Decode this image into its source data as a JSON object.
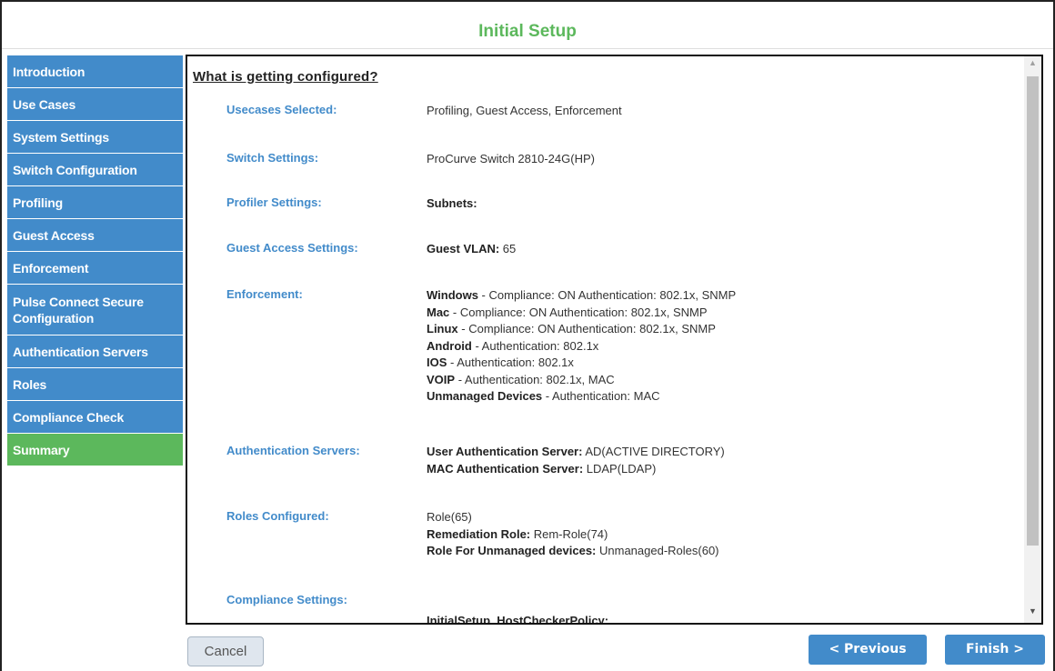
{
  "header": {
    "title": "Initial Setup"
  },
  "sidebar": {
    "items": [
      {
        "label": "Introduction"
      },
      {
        "label": "Use Cases"
      },
      {
        "label": "System Settings"
      },
      {
        "label": "Switch Configuration"
      },
      {
        "label": "Profiling"
      },
      {
        "label": "Guest Access"
      },
      {
        "label": "Enforcement"
      },
      {
        "label": "Pulse Connect Secure Configuration"
      },
      {
        "label": "Authentication Servers"
      },
      {
        "label": "Roles"
      },
      {
        "label": "Compliance Check"
      },
      {
        "label": "Summary",
        "active": true
      }
    ]
  },
  "content": {
    "heading": "What is getting configured?",
    "usecases": {
      "label": "Usecases Selected:",
      "value": "Profiling, Guest Access, Enforcement"
    },
    "switch": {
      "label": "Switch Settings:",
      "value": "ProCurve Switch 2810-24G(HP)"
    },
    "profiler": {
      "label": "Profiler Settings:",
      "key": "Subnets:"
    },
    "guest": {
      "label": "Guest Access Settings:",
      "key": "Guest VLAN:",
      "value": " 65"
    },
    "enforcement": {
      "label": "Enforcement:",
      "lines": [
        {
          "key": "Windows",
          "value": " - Compliance: ON Authentication: 802.1x, SNMP"
        },
        {
          "key": "Mac",
          "value": " - Compliance: ON Authentication: 802.1x, SNMP"
        },
        {
          "key": "Linux",
          "value": " - Compliance: ON Authentication: 802.1x, SNMP"
        },
        {
          "key": "Android",
          "value": " - Authentication: 802.1x"
        },
        {
          "key": "IOS",
          "value": " - Authentication: 802.1x"
        },
        {
          "key": "VOIP",
          "value": " - Authentication: 802.1x, MAC"
        },
        {
          "key": "Unmanaged Devices",
          "value": " - Authentication: MAC"
        }
      ]
    },
    "auth_servers": {
      "label": "Authentication Servers:",
      "lines": [
        {
          "key": "User Authentication Server:",
          "value": " AD(ACTIVE DIRECTORY)"
        },
        {
          "key": "MAC Authentication Server:",
          "value": " LDAP(LDAP)"
        }
      ]
    },
    "roles": {
      "label": "Roles Configured:",
      "plain": "Role(65)",
      "lines": [
        {
          "key": "Remediation Role:",
          "value": " Rem-Role(74)"
        },
        {
          "key": "Role For Unmanaged devices:",
          "value": " Unmanaged-Roles(60)"
        }
      ]
    },
    "compliance": {
      "label": "Compliance Settings:",
      "key": "InitialSetup_HostCheckerPolicy:"
    }
  },
  "footer": {
    "cancel_label": "Cancel",
    "previous_label": "< Previous",
    "finish_label": "Finish >"
  }
}
